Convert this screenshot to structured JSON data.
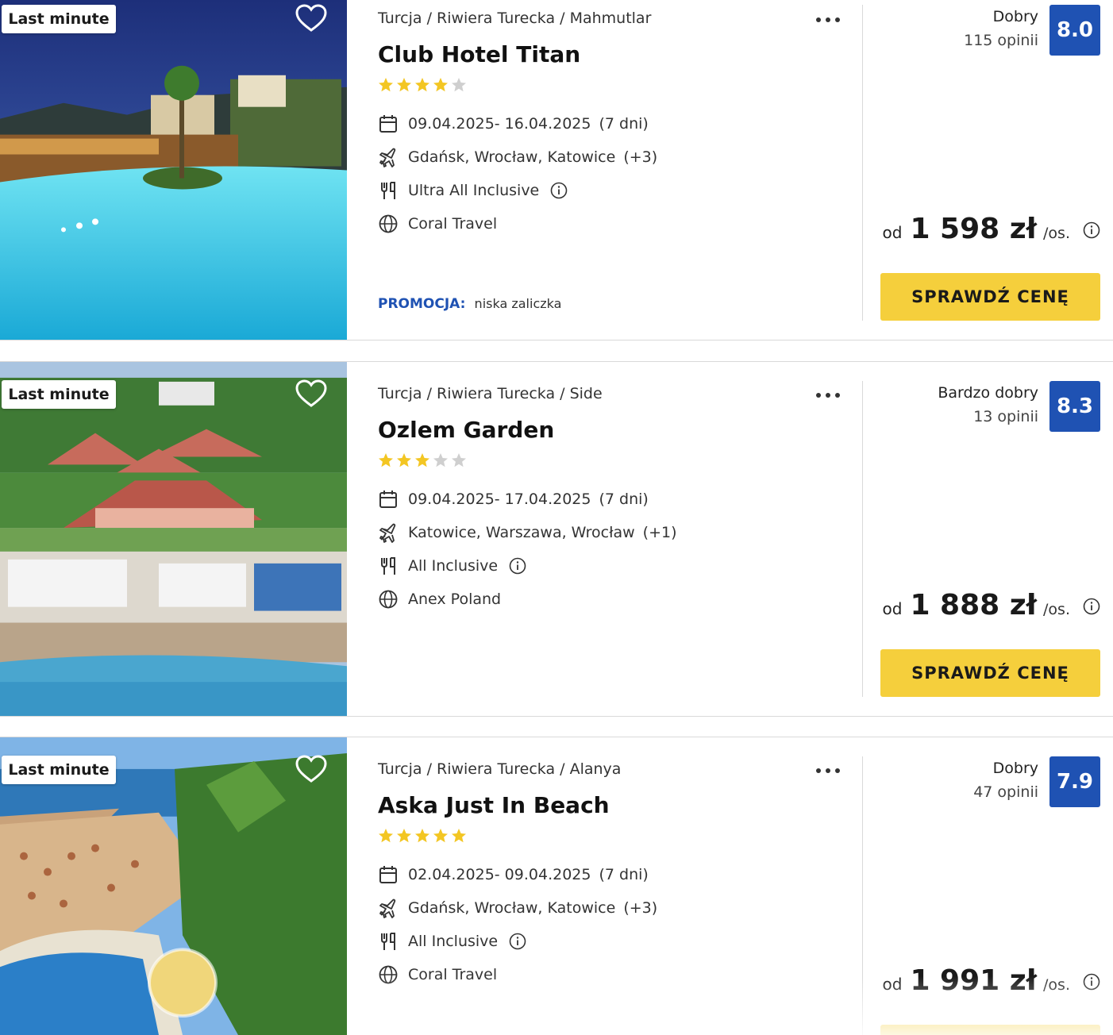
{
  "offers": [
    {
      "badge": "Last minute",
      "breadcrumb": "Turcja / Riwiera Turecka / Mahmutlar",
      "name": "Club Hotel Titan",
      "stars": 4,
      "dates": "09.04.2025- 16.04.2025",
      "duration": "(7 dni)",
      "airports": "Gdańsk, Wrocław, Katowice",
      "airports_more": "(+3)",
      "board": "Ultra All Inclusive",
      "operator": "Coral Travel",
      "promo_label": "PROMOCJA:",
      "promo_text": "niska zaliczka",
      "rating_label": "Dobry",
      "rating_count": "115 opinii",
      "score": "8.0",
      "price_prefix": "od",
      "price": "1 598 zł",
      "price_suffix": "/os.",
      "cta": "SPRAWDŹ CENĘ"
    },
    {
      "badge": "Last minute",
      "breadcrumb": "Turcja / Riwiera Turecka / Side",
      "name": "Ozlem Garden",
      "stars": 3,
      "dates": "09.04.2025- 17.04.2025",
      "duration": "(7 dni)",
      "airports": "Katowice, Warszawa, Wrocław",
      "airports_more": "(+1)",
      "board": "All Inclusive",
      "operator": "Anex Poland",
      "rating_label": "Bardzo dobry",
      "rating_count": "13 opinii",
      "score": "8.3",
      "price_prefix": "od",
      "price": "1 888 zł",
      "price_suffix": "/os.",
      "cta": "SPRAWDŹ CENĘ"
    },
    {
      "badge": "Last minute",
      "breadcrumb": "Turcja / Riwiera Turecka / Alanya",
      "name": "Aska Just In Beach",
      "stars": 5,
      "dates": "02.04.2025- 09.04.2025",
      "duration": "(7 dni)",
      "airports": "Gdańsk, Wrocław, Katowice",
      "airports_more": "(+3)",
      "board": "All Inclusive",
      "operator": "Coral Travel",
      "rating_label": "Dobry",
      "rating_count": "47 opinii",
      "score": "7.9",
      "price_prefix": "od",
      "price": "1 991 zł",
      "price_suffix": "/os."
    }
  ],
  "colors": {
    "brand_blue": "#1f52b3",
    "cta_yellow": "#f5cf3c",
    "star_gold": "#f3c623",
    "star_grey": "#cfcfcf"
  },
  "icons": [
    "heart-icon",
    "more-dots-icon",
    "star-icon",
    "calendar-icon",
    "plane-icon",
    "cutlery-icon",
    "info-icon",
    "globe-icon"
  ]
}
